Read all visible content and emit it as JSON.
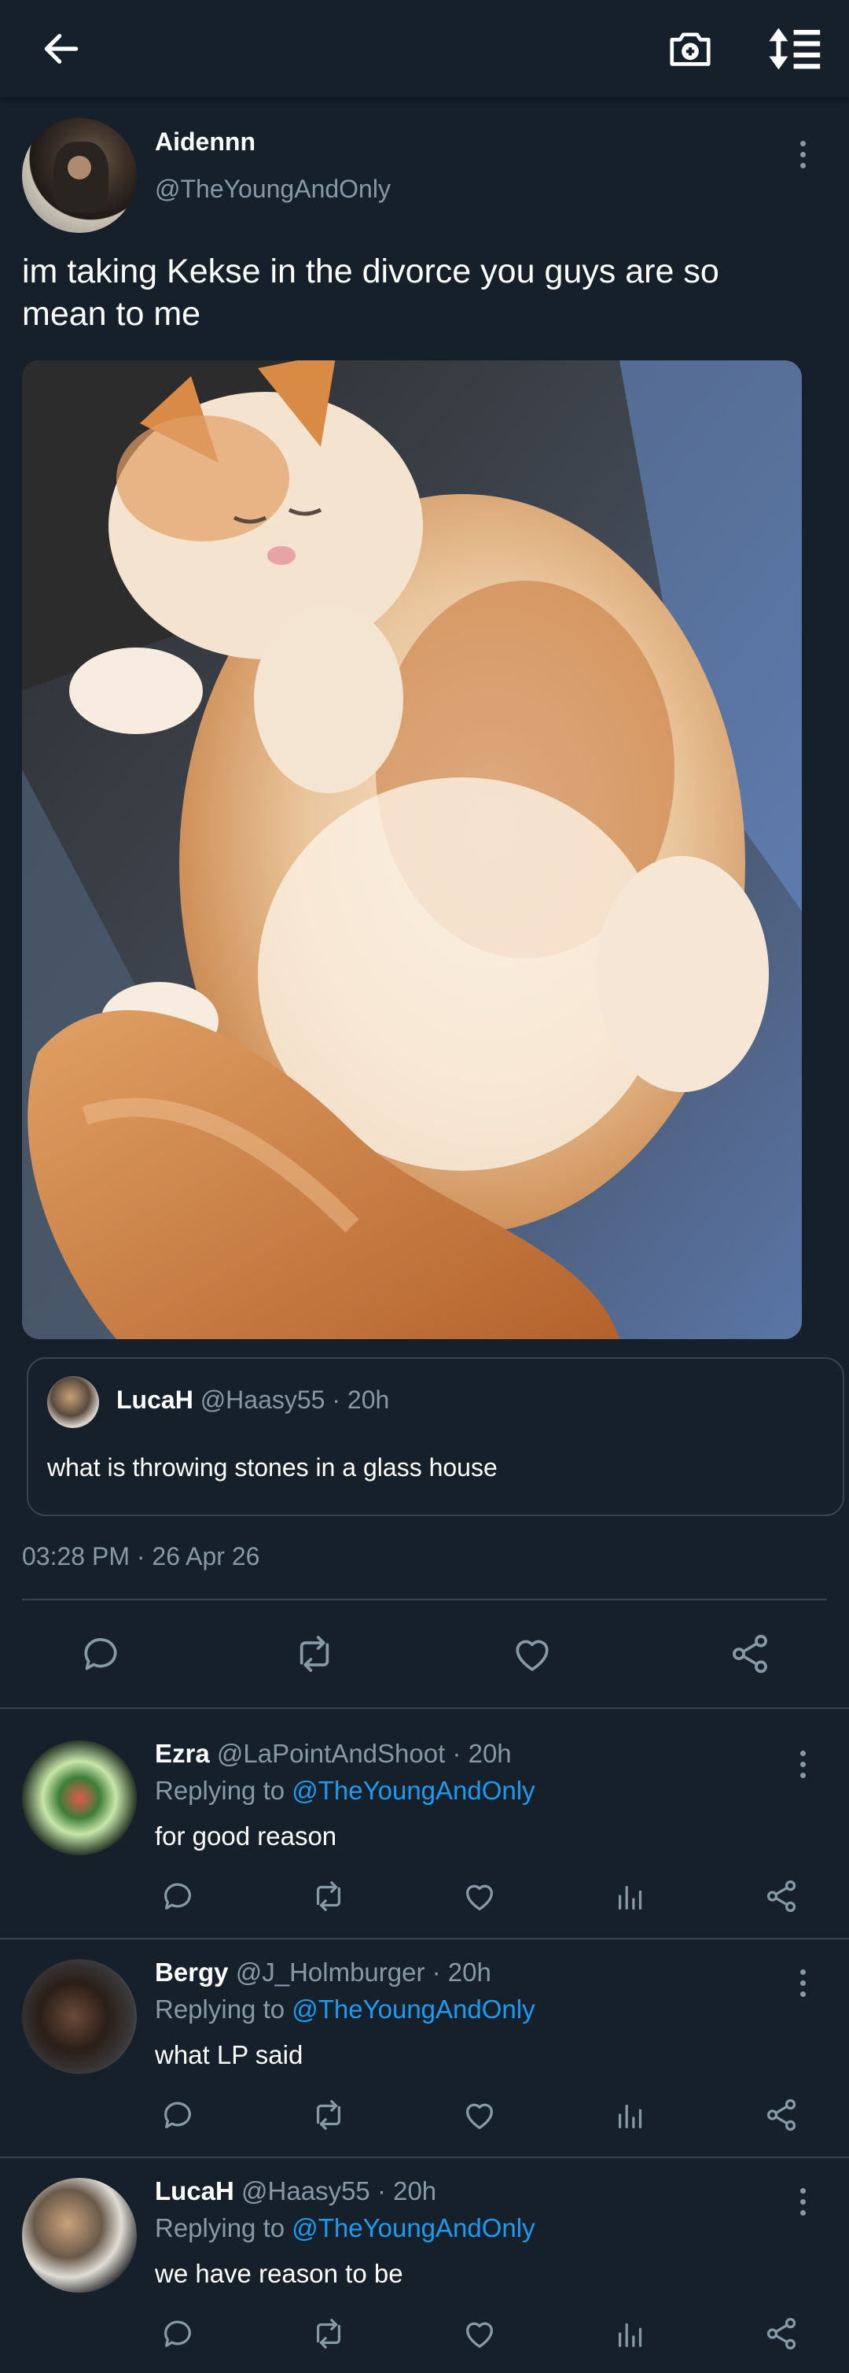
{
  "header": {
    "back_icon": "arrow-left-icon",
    "camera_icon": "camera-plus-icon",
    "sort_icon": "sort-list-icon"
  },
  "tweet": {
    "name": "Aidennn",
    "handle": "@TheYoungAndOnly",
    "text": "im taking Kekse in the divorce you guys are so mean to me",
    "timestamp": "03:28 PM · 26 Apr 26",
    "quote": {
      "name": "LucaH",
      "handle_time": "@Haasy55 · 20h",
      "text": "what is throwing stones in a glass house"
    }
  },
  "replies": [
    {
      "name": "Ezra",
      "handle_time": "@LaPointAndShoot · 20h",
      "replying_prefix": "Replying to ",
      "replying_to": "@TheYoungAndOnly",
      "text": "for good reason"
    },
    {
      "name": "Bergy",
      "handle_time": "@J_Holmburger · 20h",
      "replying_prefix": "Replying to ",
      "replying_to": "@TheYoungAndOnly",
      "text": "what LP said"
    },
    {
      "name": "LucaH",
      "handle_time": "@Haasy55 · 20h",
      "replying_prefix": "Replying to ",
      "replying_to": "@TheYoungAndOnly",
      "text": "we have reason to be"
    }
  ],
  "colors": {
    "background": "#15202b",
    "secondary_text": "#8899a6",
    "link": "#1d9bf0",
    "divider": "#38444d"
  }
}
